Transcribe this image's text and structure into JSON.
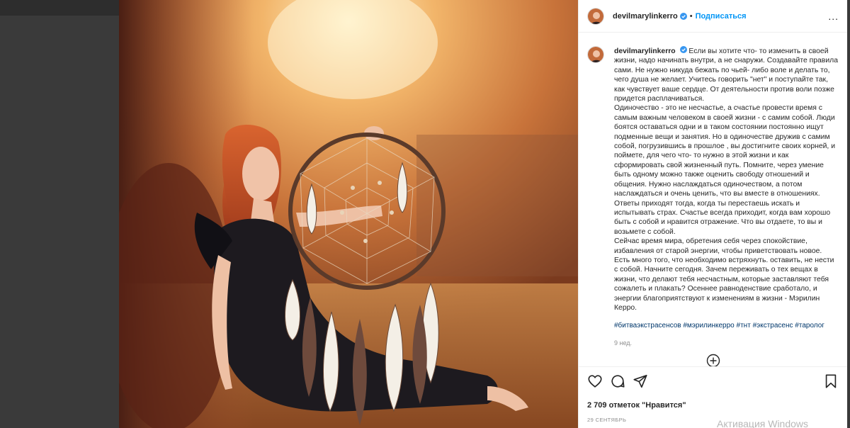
{
  "post": {
    "username": "devilmarylinkerro",
    "dot": "•",
    "follow_label": "Подписаться",
    "more_label": "...",
    "caption": [
      "Если вы хотите что- то изменить в своей жизни, надо начинать внутри, а не снаружи. Создавайте правила сами. Не нужно никуда бежать по чьей- либо воле и делать то, чего душа не желает. Учитесь говорить \"нет\" и поступайте так, как чувствует ваше сердце. От деятельности против воли позже придется расплачиваться.",
      "Одиночество - это не несчастье, а счастье провести время с самым важным человеком в своей жизни - с самим собой. Люди боятся оставаться одни и в таком состоянии постоянно ищут подменные вещи и занятия. Но в одиночестве дружив с самим собой, погрузившись в прошлое , вы достигните своих корней, и поймете, для чего что- то нужно в этой жизни и как сформировать свой жизненный путь. Помните, через умение быть одному можно также оценить свободу отношений и общения. Нужно наслаждаться одиночеством, а потом наслаждаться и очень ценить, что вы вместе в отношениях. Ответы приходят тогда, когда ты перестаешь искать и испытывать страх. Счастье всегда приходит, когда вам хорошо быть с собой и нравится отражение. Что вы отдаете, то вы и возьмете с собой.",
      "Сейчас время мира, обретения себя через спокойствие, избавления от старой энергии, чтобы приветствовать новое. Есть много того, что необходимо встряхнуть. оставить, не нести с собой. Начните сегодня. Зачем переживать о тех вещах в жизни, что делают тебя несчастным, которые заставляют тебя сожалеть и плакать? Осеннее равноденствие сработало, и энергии благоприятствуют к изменениям в жизни - Мэрилин Керро."
    ],
    "hashtags": [
      "#битваэкстрасенсов",
      "#мэрилинкерро",
      "#тнт",
      "#экстрасенс",
      "#таролог"
    ],
    "time_ago": "9 нед.",
    "likes": "2 709 отметок \"Нравится\"",
    "date": "29 СЕНТЯБРЬ",
    "watermark": "Активация Windows"
  },
  "icons": {
    "like": "heart-icon",
    "comment": "comment-icon",
    "share": "share-icon",
    "save": "bookmark-icon",
    "load_more": "plus-circle-icon",
    "verified": "verified-badge-icon"
  },
  "colors": {
    "link_blue": "#0095f6",
    "hashtag": "#00376b",
    "secondary_text": "#8e8e8e",
    "text": "#262626",
    "page_dark": "#3a3a3a"
  }
}
